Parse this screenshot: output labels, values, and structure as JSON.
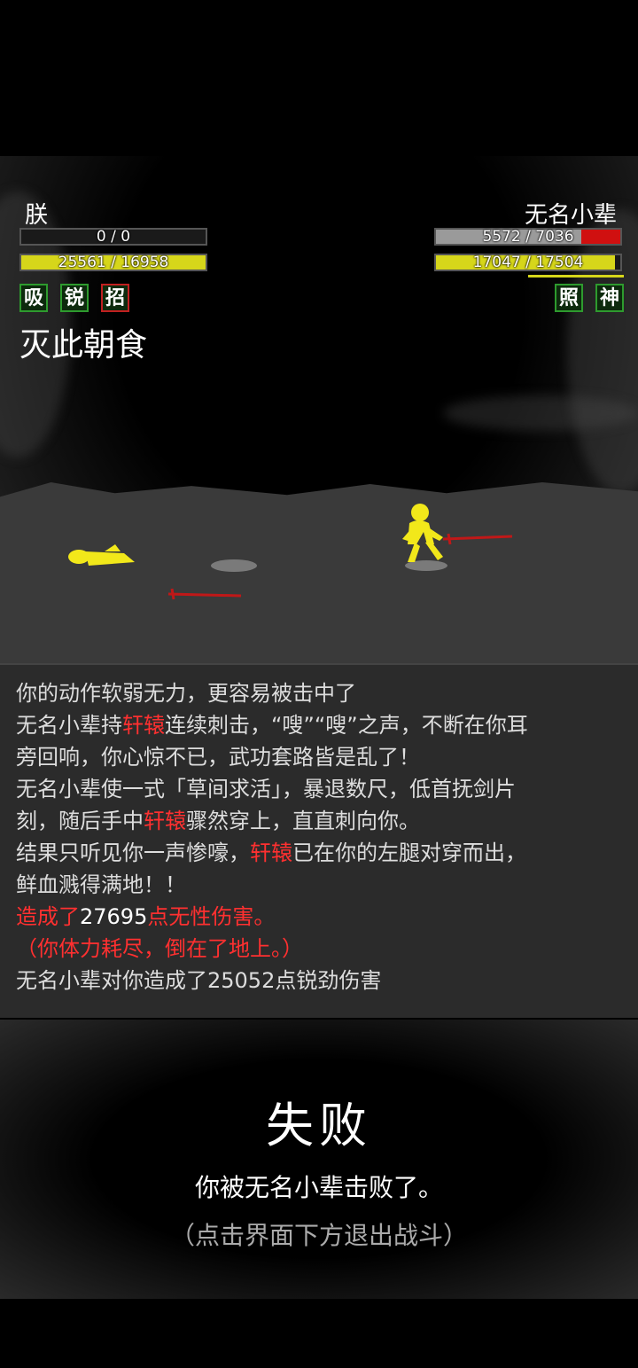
{
  "player": {
    "name": "朕",
    "hp_text": "0 / 0",
    "hp_fraction": 0,
    "mp_text": "25561 / 16958",
    "mp_fraction": 1.0,
    "skills": [
      "吸",
      "锐",
      "招"
    ],
    "current_move": "灭此朝食"
  },
  "enemy": {
    "name": "无名小辈",
    "hp_text": "5572 / 7036",
    "hp_fraction": 0.79,
    "mp_text": "17047 / 17504",
    "mp_fraction": 0.97,
    "skills": [
      "照",
      "神"
    ]
  },
  "log": {
    "lines": [
      [
        {
          "t": "你的动作软弱无力，更容易被击中了",
          "c": "n"
        }
      ],
      [
        {
          "t": "无名小辈持",
          "c": "n"
        },
        {
          "t": "轩辕",
          "c": "r"
        },
        {
          "t": "连续刺击，“嗖”“嗖”之声，不断在你耳",
          "c": "n"
        }
      ],
      [
        {
          "t": "旁回响，你心惊不已，武功套路皆是乱了！",
          "c": "n"
        }
      ],
      [
        {
          "t": "无名小辈使一式「草间求活」，暴退数尺，低首抚剑片",
          "c": "n"
        }
      ],
      [
        {
          "t": "刻，随后手中",
          "c": "n"
        },
        {
          "t": "轩辕",
          "c": "r"
        },
        {
          "t": "骤然穿上，直直刺向你。",
          "c": "n"
        }
      ],
      [
        {
          "t": "结果只听见你一声惨嚎，",
          "c": "n"
        },
        {
          "t": "轩辕",
          "c": "r"
        },
        {
          "t": "已在你的左腿对穿而出，",
          "c": "n"
        }
      ],
      [
        {
          "t": "鲜血溅得满地！！",
          "c": "n"
        }
      ],
      [
        {
          "t": "造成了",
          "c": "r"
        },
        {
          "t": "27695",
          "c": "w"
        },
        {
          "t": "点无性伤害。",
          "c": "r"
        }
      ],
      [
        {
          "t": "（你体力耗尽，倒在了地上。）",
          "c": "r"
        }
      ],
      [
        {
          "t": "无名小辈对你造成了25052点锐劲伤害",
          "c": "n"
        }
      ]
    ]
  },
  "result": {
    "title": "失败",
    "description": "你被无名小辈击败了。",
    "hint": "（点击界面下方退出战斗）"
  },
  "colors": {
    "hp_enemy": "#d01010",
    "hp_enemy_remaining": "#9a9a9a",
    "mp": "#d6d61a",
    "skill_border": "#2e9b2e",
    "skill_border_active": "#c02020",
    "highlight": "#ff3030",
    "figure": "#f2e81a",
    "sword": "#c01818"
  },
  "icons": [
    "player-fallen-figure-icon",
    "enemy-figure-icon",
    "sword-icon"
  ]
}
